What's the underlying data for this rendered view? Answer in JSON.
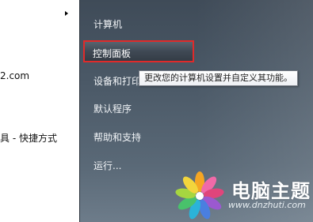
{
  "left_list": {
    "item_domain": "2.com",
    "item_shortcut": "具 - 快捷方式"
  },
  "start_menu": {
    "items": [
      {
        "label": "计算机"
      },
      {
        "label": "控制面板"
      },
      {
        "label": "设备和打印"
      },
      {
        "label": "默认程序"
      },
      {
        "label": "帮助和支持"
      },
      {
        "label": "运行..."
      }
    ],
    "highlighted_index": 1
  },
  "tooltip": {
    "text": "更改您的计算机设置并自定义其功能。"
  },
  "watermark": {
    "cn_text": "电脑主题",
    "url": "www.dnzhuti.com"
  },
  "colors": {
    "menu_bg": "#4a5866",
    "highlight_border": "#e02a2a",
    "text_light": "#f2f5f8"
  }
}
